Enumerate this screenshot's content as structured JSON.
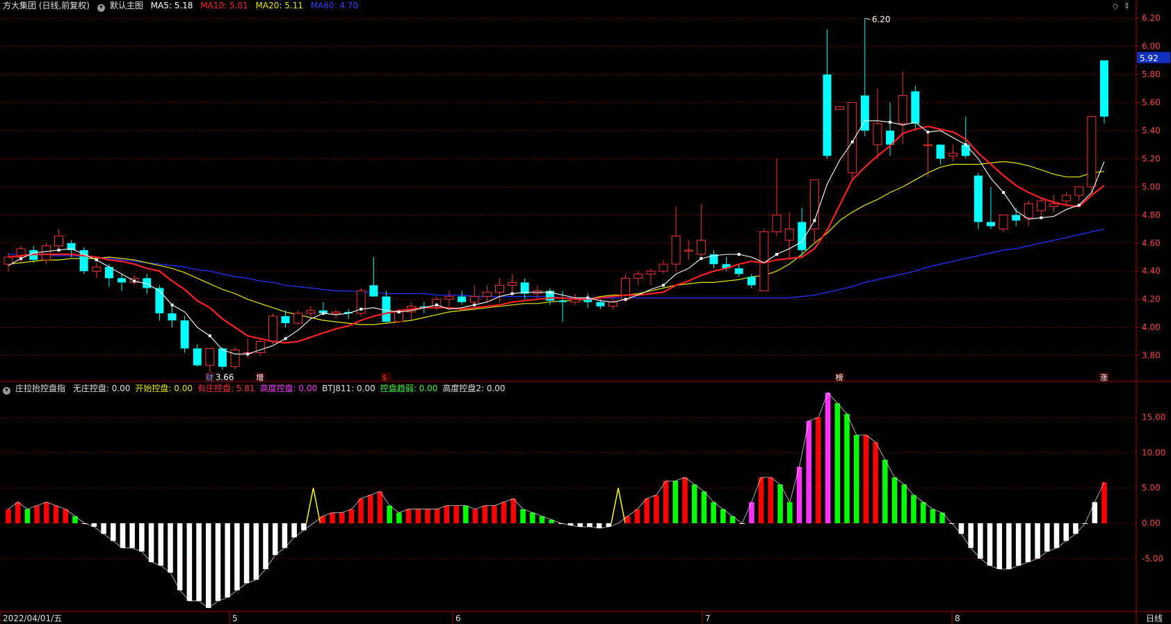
{
  "header": {
    "title": "方大集团 (日线,前复权)",
    "chart_name": "默认主图",
    "ma5": "MA5: 5.18",
    "ma10": "MA10: 5.01",
    "ma20": "MA20: 5.11",
    "ma60": "MA60: 4.70"
  },
  "indicator_header": {
    "name": "庄拉抬控盘指",
    "items": [
      {
        "text": "无庄控盘: 0.00",
        "color": "#e0e0e0"
      },
      {
        "text": "开始控盘: 0.00",
        "color": "#e8e800"
      },
      {
        "text": "有庄控盘: 5.81",
        "color": "#ff3030"
      },
      {
        "text": "高度控盘: 0.00",
        "color": "#ff30ff"
      },
      {
        "text": "BTJ811: 0.00",
        "color": "#e0e0e0"
      },
      {
        "text": "控盘趋弱: 0.00",
        "color": "#30ff30"
      },
      {
        "text": "高度控盘2: 0.00",
        "color": "#e0e0e0"
      }
    ]
  },
  "current_price_label": "5.92",
  "high_label": "6.20",
  "low_label": "3.66",
  "event_markers": [
    {
      "text": "财",
      "index": 16,
      "color": "#5a9bff"
    },
    {
      "text": "增",
      "index": 20,
      "color": "#ffffff"
    },
    {
      "text": "$",
      "index": 30,
      "color": "#ff3030"
    },
    {
      "text": "榜",
      "index": 66,
      "color": "#ffffff"
    },
    {
      "text": "涨",
      "index": 87,
      "color": "#ffffff"
    }
  ],
  "x_axis_labels": [
    "2022/04/01/五",
    "5",
    "6",
    "7",
    "8"
  ],
  "period_label": "日线",
  "colors": {
    "up": "#ff3030",
    "down": "#00ffff",
    "ma5": "#ffffff",
    "ma10": "#ff2020",
    "ma20": "#e8e800",
    "ma60": "#2030ff",
    "grid": "#6a0000",
    "axis": "#b00000",
    "bar_red": "#ff0000",
    "bar_green": "#00ff00",
    "bar_magenta": "#ff30ff",
    "bar_white": "#ffffff",
    "bar_yellow": "#ffff00"
  },
  "chart_data": [
    {
      "type": "candlestick",
      "title": "方大集团 (日线,前复权)",
      "y_ticks": [
        3.8,
        4.0,
        4.2,
        4.4,
        4.6,
        4.8,
        5.0,
        5.2,
        5.4,
        5.6,
        5.8,
        6.0,
        6.2
      ],
      "ylim": [
        3.62,
        6.29
      ],
      "ohlc": [
        [
          4.45,
          4.53,
          4.4,
          4.5
        ],
        [
          4.5,
          4.58,
          4.46,
          4.56
        ],
        [
          4.55,
          4.58,
          4.46,
          4.48
        ],
        [
          4.48,
          4.6,
          4.45,
          4.58
        ],
        [
          4.58,
          4.7,
          4.55,
          4.65
        ],
        [
          4.6,
          4.62,
          4.5,
          4.55
        ],
        [
          4.55,
          4.57,
          4.38,
          4.4
        ],
        [
          4.4,
          4.46,
          4.35,
          4.43
        ],
        [
          4.43,
          4.45,
          4.29,
          4.35
        ],
        [
          4.35,
          4.38,
          4.26,
          4.32
        ],
        [
          4.32,
          4.37,
          4.3,
          4.35
        ],
        [
          4.35,
          4.38,
          4.24,
          4.28
        ],
        [
          4.28,
          4.3,
          4.05,
          4.1
        ],
        [
          4.1,
          4.15,
          4.0,
          4.05
        ],
        [
          4.05,
          4.08,
          3.82,
          3.85
        ],
        [
          3.85,
          3.88,
          3.72,
          3.73
        ],
        [
          3.73,
          3.85,
          3.66,
          3.85
        ],
        [
          3.85,
          3.86,
          3.7,
          3.72
        ],
        [
          3.72,
          3.86,
          3.7,
          3.84
        ],
        [
          3.82,
          3.92,
          3.78,
          3.82
        ],
        [
          3.82,
          3.92,
          3.8,
          3.9
        ],
        [
          3.9,
          4.1,
          3.88,
          4.08
        ],
        [
          4.08,
          4.12,
          4.0,
          4.03
        ],
        [
          4.03,
          4.12,
          4.02,
          4.1
        ],
        [
          4.1,
          4.15,
          4.08,
          4.12
        ],
        [
          4.12,
          4.18,
          4.09,
          4.1
        ],
        [
          4.1,
          4.13,
          4.06,
          4.11
        ],
        [
          4.11,
          4.13,
          4.06,
          4.1
        ],
        [
          4.1,
          4.28,
          4.08,
          4.26
        ],
        [
          4.3,
          4.5,
          4.25,
          4.22
        ],
        [
          4.22,
          4.26,
          4.03,
          4.04
        ],
        [
          4.04,
          4.13,
          4.03,
          4.11
        ],
        [
          4.11,
          4.18,
          4.06,
          4.15
        ],
        [
          4.15,
          4.18,
          4.1,
          4.14
        ],
        [
          4.14,
          4.22,
          4.12,
          4.2
        ],
        [
          4.2,
          4.26,
          4.15,
          4.22
        ],
        [
          4.22,
          4.26,
          4.16,
          4.18
        ],
        [
          4.18,
          4.3,
          4.15,
          4.22
        ],
        [
          4.22,
          4.3,
          4.18,
          4.25
        ],
        [
          4.25,
          4.35,
          4.18,
          4.3
        ],
        [
          4.3,
          4.38,
          4.25,
          4.32
        ],
        [
          4.32,
          4.35,
          4.2,
          4.24
        ],
        [
          4.24,
          4.3,
          4.2,
          4.26
        ],
        [
          4.26,
          4.28,
          4.16,
          4.19
        ],
        [
          4.19,
          4.26,
          4.04,
          4.18
        ],
        [
          4.18,
          4.24,
          4.16,
          4.2
        ],
        [
          4.2,
          4.24,
          4.14,
          4.18
        ],
        [
          4.18,
          4.2,
          4.13,
          4.15
        ],
        [
          4.15,
          4.2,
          4.13,
          4.18
        ],
        [
          4.2,
          4.38,
          4.18,
          4.35
        ],
        [
          4.35,
          4.4,
          4.3,
          4.38
        ],
        [
          4.38,
          4.42,
          4.3,
          4.4
        ],
        [
          4.4,
          4.48,
          4.38,
          4.45
        ],
        [
          4.45,
          4.86,
          4.4,
          4.65
        ],
        [
          4.55,
          4.62,
          4.48,
          4.55
        ],
        [
          4.52,
          4.88,
          4.48,
          4.62
        ],
        [
          4.52,
          4.55,
          4.42,
          4.45
        ],
        [
          4.45,
          4.5,
          4.4,
          4.42
        ],
        [
          4.42,
          4.45,
          4.36,
          4.38
        ],
        [
          4.36,
          4.38,
          4.28,
          4.3
        ],
        [
          4.26,
          4.7,
          4.26,
          4.68
        ],
        [
          4.68,
          5.2,
          4.65,
          4.8
        ],
        [
          4.62,
          4.82,
          4.48,
          4.7
        ],
        [
          4.75,
          4.85,
          4.5,
          4.55
        ],
        [
          4.7,
          5.05,
          4.6,
          5.05
        ],
        [
          5.8,
          6.12,
          5.2,
          5.22
        ],
        [
          5.55,
          5.55,
          5.55,
          5.57
        ],
        [
          5.1,
          5.6,
          5.05,
          5.6
        ],
        [
          5.65,
          6.2,
          5.36,
          5.4
        ],
        [
          5.3,
          5.7,
          5.2,
          5.45
        ],
        [
          5.4,
          5.6,
          5.22,
          5.3
        ],
        [
          5.45,
          5.82,
          5.3,
          5.65
        ],
        [
          5.68,
          5.72,
          5.4,
          5.45
        ],
        [
          5.3,
          5.38,
          5.07,
          5.3
        ],
        [
          5.3,
          5.3,
          5.16,
          5.2
        ],
        [
          5.22,
          5.3,
          5.18,
          5.24
        ],
        [
          5.3,
          5.5,
          5.2,
          5.22
        ],
        [
          5.08,
          5.1,
          4.7,
          4.75
        ],
        [
          4.75,
          5.0,
          4.7,
          4.72
        ],
        [
          4.7,
          4.8,
          4.68,
          4.8
        ],
        [
          4.8,
          4.85,
          4.72,
          4.76
        ],
        [
          4.78,
          4.9,
          4.72,
          4.88
        ],
        [
          4.83,
          4.92,
          4.8,
          4.9
        ],
        [
          4.86,
          4.94,
          4.82,
          4.88
        ],
        [
          4.9,
          4.96,
          4.86,
          4.94
        ],
        [
          4.94,
          5.0,
          4.9,
          5.0
        ],
        [
          5.0,
          5.5,
          4.95,
          5.5
        ],
        [
          5.9,
          5.9,
          5.45,
          5.5
        ]
      ],
      "series": [
        {
          "name": "MA5",
          "values": [
            4.44,
            4.49,
            4.53,
            4.54,
            4.55,
            4.56,
            4.52,
            4.48,
            4.43,
            4.38,
            4.33,
            4.31,
            4.26,
            4.16,
            4.11,
            4.0,
            3.94,
            3.84,
            3.81,
            3.81,
            3.84,
            3.87,
            3.92,
            3.98,
            4.06,
            4.1,
            4.09,
            4.1,
            4.13,
            4.14,
            4.12,
            4.11,
            4.12,
            4.14,
            4.16,
            4.13,
            4.14,
            4.16,
            4.18,
            4.22,
            4.24,
            4.25,
            4.25,
            4.25,
            4.23,
            4.21,
            4.21,
            4.19,
            4.18,
            4.2,
            4.23,
            4.27,
            4.3,
            4.38,
            4.42,
            4.49,
            4.51,
            4.52,
            4.52,
            4.5,
            4.46,
            4.52,
            4.56,
            4.61,
            4.76,
            5.02,
            5.19,
            5.32,
            5.47,
            5.47,
            5.46,
            5.44,
            5.46,
            5.39,
            5.4,
            5.35,
            5.3,
            5.2,
            5.06,
            4.96,
            4.83,
            4.77,
            4.78,
            4.79,
            4.84,
            4.87,
            4.96,
            5.18
          ]
        },
        {
          "name": "MA10",
          "values": [
            4.5,
            4.51,
            4.52,
            4.52,
            4.52,
            4.52,
            4.51,
            4.5,
            4.48,
            4.47,
            4.45,
            4.42,
            4.4,
            4.33,
            4.27,
            4.19,
            4.14,
            4.06,
            4.0,
            3.94,
            3.92,
            3.9,
            3.89,
            3.9,
            3.93,
            3.96,
            3.99,
            4.01,
            4.05,
            4.08,
            4.1,
            4.12,
            4.13,
            4.14,
            4.14,
            4.14,
            4.13,
            4.14,
            4.15,
            4.16,
            4.18,
            4.19,
            4.2,
            4.21,
            4.21,
            4.2,
            4.2,
            4.21,
            4.22,
            4.23,
            4.23,
            4.24,
            4.25,
            4.3,
            4.33,
            4.37,
            4.4,
            4.42,
            4.45,
            4.47,
            4.46,
            4.48,
            4.49,
            4.5,
            4.56,
            4.69,
            4.87,
            5.05,
            5.14,
            5.22,
            5.29,
            5.38,
            5.41,
            5.43,
            5.41,
            5.39,
            5.34,
            5.24,
            5.16,
            5.08,
            5.01,
            4.96,
            4.92,
            4.89,
            4.87,
            4.86,
            4.94,
            5.01
          ]
        },
        {
          "name": "MA20",
          "values": [
            4.45,
            4.46,
            4.47,
            4.48,
            4.48,
            4.49,
            4.49,
            4.49,
            4.5,
            4.49,
            4.48,
            4.46,
            4.44,
            4.42,
            4.39,
            4.35,
            4.31,
            4.27,
            4.24,
            4.2,
            4.17,
            4.14,
            4.11,
            4.09,
            4.07,
            4.05,
            4.04,
            4.03,
            4.02,
            4.02,
            4.03,
            4.04,
            4.05,
            4.07,
            4.09,
            4.11,
            4.12,
            4.13,
            4.14,
            4.15,
            4.16,
            4.17,
            4.17,
            4.18,
            4.19,
            4.19,
            4.2,
            4.22,
            4.23,
            4.23,
            4.24,
            4.26,
            4.28,
            4.3,
            4.31,
            4.32,
            4.32,
            4.33,
            4.34,
            4.36,
            4.37,
            4.4,
            4.45,
            4.52,
            4.6,
            4.67,
            4.76,
            4.82,
            4.87,
            4.91,
            4.96,
            5.0,
            5.05,
            5.1,
            5.14,
            5.16,
            5.16,
            5.16,
            5.17,
            5.18,
            5.17,
            5.15,
            5.12,
            5.09,
            5.07,
            5.07,
            5.1,
            5.11
          ]
        },
        {
          "name": "MA60",
          "values": [
            4.52,
            4.52,
            4.52,
            4.51,
            4.51,
            4.51,
            4.5,
            4.5,
            4.49,
            4.48,
            4.47,
            4.46,
            4.45,
            4.44,
            4.43,
            4.41,
            4.4,
            4.38,
            4.36,
            4.35,
            4.33,
            4.32,
            4.3,
            4.29,
            4.28,
            4.27,
            4.26,
            4.26,
            4.25,
            4.25,
            4.24,
            4.24,
            4.24,
            4.24,
            4.23,
            4.23,
            4.23,
            4.22,
            4.22,
            4.22,
            4.22,
            4.22,
            4.22,
            4.22,
            4.21,
            4.21,
            4.21,
            4.21,
            4.21,
            4.21,
            4.21,
            4.21,
            4.21,
            4.21,
            4.21,
            4.21,
            4.21,
            4.21,
            4.21,
            4.21,
            4.21,
            4.21,
            4.21,
            4.22,
            4.23,
            4.25,
            4.27,
            4.29,
            4.32,
            4.34,
            4.36,
            4.38,
            4.4,
            4.43,
            4.45,
            4.47,
            4.49,
            4.51,
            4.53,
            4.55,
            4.56,
            4.58,
            4.6,
            4.62,
            4.64,
            4.66,
            4.68,
            4.7
          ]
        }
      ]
    },
    {
      "type": "bar",
      "title": "庄拉抬控盘指",
      "y_ticks": [
        -5.0,
        0.0,
        5.0,
        10.0,
        15.0
      ],
      "ylim": [
        -12.5,
        19
      ],
      "values": [
        2,
        3,
        2,
        2.5,
        3,
        2.5,
        2,
        1,
        0,
        -0.5,
        -1.5,
        -2.5,
        -3.5,
        -3.5,
        -4,
        -5.5,
        -6,
        -7,
        -9.5,
        -11,
        -11,
        -12,
        -11,
        -10.5,
        -9.5,
        -8.5,
        -8,
        -6.5,
        -4.5,
        -3.5,
        -2,
        -1,
        0,
        1,
        1.5,
        1.5,
        2,
        3.5,
        4,
        4.5,
        2.5,
        1.5,
        2,
        2,
        2,
        2,
        2.5,
        2.5,
        2.5,
        2,
        2.5,
        2.5,
        3,
        3.5,
        2,
        1.5,
        1,
        0.5,
        0,
        -0.3,
        -0.5,
        -0.5,
        -0.7,
        -0.5,
        0,
        1,
        2,
        3.5,
        4,
        6,
        6,
        6.5,
        5.5,
        4.5,
        3,
        2,
        1,
        0,
        3,
        6.5,
        6.5,
        5.5,
        3,
        8,
        14.5,
        15,
        18.5,
        17,
        15.5,
        12.5,
        12.5,
        11.5,
        9,
        6.5,
        5.5,
        4,
        3,
        2,
        1.5,
        0,
        -1.5,
        -3.5,
        -5,
        -6,
        -6.5,
        -6.5,
        -6,
        -5.5,
        -5,
        -4,
        -3.5,
        -2.5,
        -1.5,
        0,
        3,
        5.8
      ],
      "bar_colors": [
        "r",
        "r",
        "g",
        "r",
        "r",
        "r",
        "r",
        "g",
        "w",
        "w",
        "w",
        "w",
        "w",
        "w",
        "w",
        "w",
        "w",
        "w",
        "w",
        "w",
        "w",
        "w",
        "w",
        "w",
        "w",
        "w",
        "w",
        "w",
        "w",
        "w",
        "w",
        "w",
        "y",
        "r",
        "r",
        "r",
        "r",
        "r",
        "r",
        "r",
        "g",
        "g",
        "r",
        "r",
        "r",
        "r",
        "r",
        "r",
        "g",
        "r",
        "r",
        "r",
        "r",
        "r",
        "g",
        "g",
        "g",
        "g",
        "w",
        "w",
        "w",
        "w",
        "w",
        "w",
        "y",
        "r",
        "r",
        "r",
        "r",
        "r",
        "g",
        "r",
        "g",
        "g",
        "g",
        "g",
        "g",
        "w",
        "m",
        "r",
        "r",
        "g",
        "g",
        "m",
        "m",
        "r",
        "m",
        "g",
        "g",
        "g",
        "r",
        "r",
        "g",
        "g",
        "g",
        "g",
        "g",
        "g",
        "g",
        "w",
        "w",
        "w",
        "w",
        "w",
        "w",
        "w",
        "w",
        "w",
        "w",
        "w",
        "w",
        "w",
        "w",
        "w",
        "w",
        "r",
        "r"
      ]
    }
  ]
}
